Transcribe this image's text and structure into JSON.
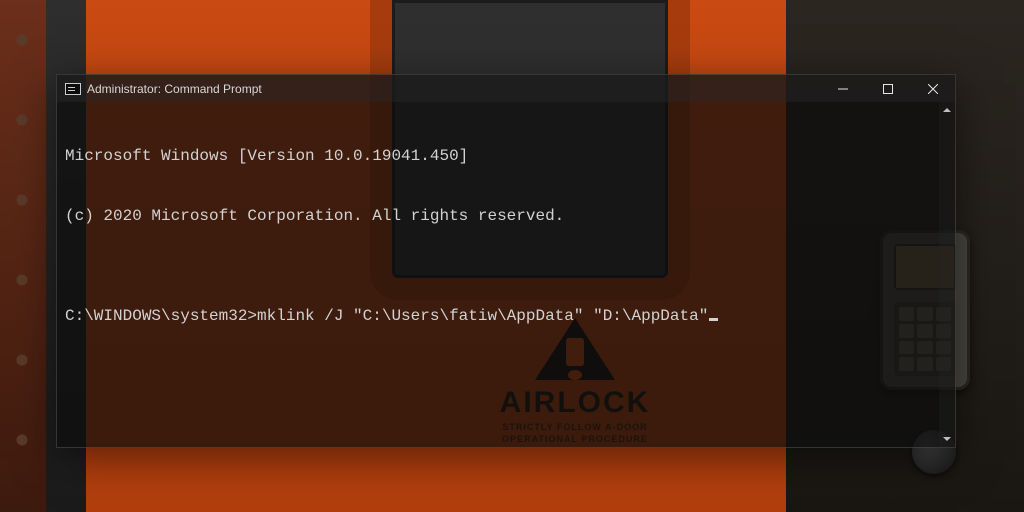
{
  "wallpaper": {
    "sign_main": "AIRLOCK",
    "sign_line1": "STRICTLY FOLLOW A-DOOR",
    "sign_line2": "OPERATIONAL PROCEDURE"
  },
  "window": {
    "title": "Administrator: Command Prompt",
    "controls": {
      "minimize": "Minimize",
      "maximize": "Maximize",
      "close": "Close"
    }
  },
  "terminal": {
    "line1": "Microsoft Windows [Version 10.0.19041.450]",
    "line2": "(c) 2020 Microsoft Corporation. All rights reserved.",
    "blank": "",
    "prompt": "C:\\WINDOWS\\system32>",
    "command": "mklink /J \"C:\\Users\\fatiw\\AppData\" \"D:\\AppData\""
  }
}
